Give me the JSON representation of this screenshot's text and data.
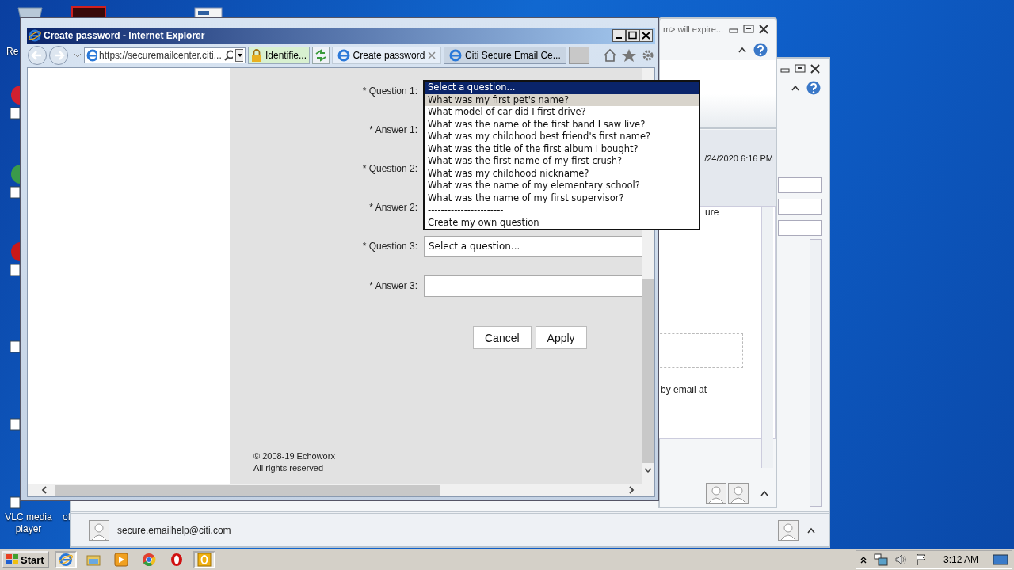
{
  "desktop": {
    "icons": [
      {
        "label": "Re"
      },
      {
        "label": "VLC media player"
      },
      {
        "label": "of"
      }
    ]
  },
  "mail_window_back": {
    "title": "m> will expire...",
    "date": "/24/2020 6:16 PM",
    "fragments": [
      "ure",
      "by email at"
    ]
  },
  "mail_window_front": {
    "sender": "secure.emailhelp@citi.com"
  },
  "browser": {
    "title": "Create password - Internet Explorer",
    "address": "https://securemailcenter.citi...",
    "site_identity": "Identifie...",
    "tabs": [
      {
        "label": "Create password",
        "selected": true
      },
      {
        "label": "Citi Secure Email Ce...",
        "selected": false
      }
    ],
    "form": {
      "rows": [
        {
          "label": "* Question 1:"
        },
        {
          "label": "* Answer 1:"
        },
        {
          "label": "* Question 2:"
        },
        {
          "label": "* Answer 2:"
        },
        {
          "label": "* Question 3:",
          "field": {
            "kind": "select",
            "value": "Select a question..."
          }
        },
        {
          "label": "* Answer 3:",
          "field": {
            "kind": "text"
          }
        }
      ],
      "buttons": [
        "Cancel",
        "Apply"
      ],
      "footer": [
        "© 2008-19 Echoworx",
        "All rights reserved"
      ]
    },
    "dropdown": {
      "options": [
        {
          "label": "Select a question...",
          "selected": true,
          "highlighted": false
        },
        {
          "label": "What was my first pet's name?",
          "selected": false,
          "highlighted": true
        },
        {
          "label": "What model of car did I first drive?",
          "selected": false,
          "highlighted": false
        },
        {
          "label": "What was the name of the first band I saw live?",
          "selected": false,
          "highlighted": false
        },
        {
          "label": "What was my childhood best friend's first name?",
          "selected": false,
          "highlighted": false
        },
        {
          "label": "What was the title of the first album I bought?",
          "selected": false,
          "highlighted": false
        },
        {
          "label": "What was the first name of my first crush?",
          "selected": false,
          "highlighted": false
        },
        {
          "label": "What was my childhood nickname?",
          "selected": false,
          "highlighted": false
        },
        {
          "label": "What was the name of my elementary school?",
          "selected": false,
          "highlighted": false
        },
        {
          "label": "What was the name of my first supervisor?",
          "selected": false,
          "highlighted": false
        },
        {
          "label": "-----------------------",
          "selected": false,
          "highlighted": false
        },
        {
          "label": "Create my own question",
          "selected": false,
          "highlighted": false
        }
      ]
    }
  },
  "taskbar": {
    "start": "Start",
    "apps": [
      {
        "kind": "ie",
        "open": true
      },
      {
        "kind": "folder",
        "open": false
      },
      {
        "kind": "media",
        "open": false
      },
      {
        "kind": "chrome",
        "open": false
      },
      {
        "kind": "opera",
        "open": false
      },
      {
        "kind": "outlook",
        "open": true
      }
    ],
    "clock": "3:12 AM"
  }
}
